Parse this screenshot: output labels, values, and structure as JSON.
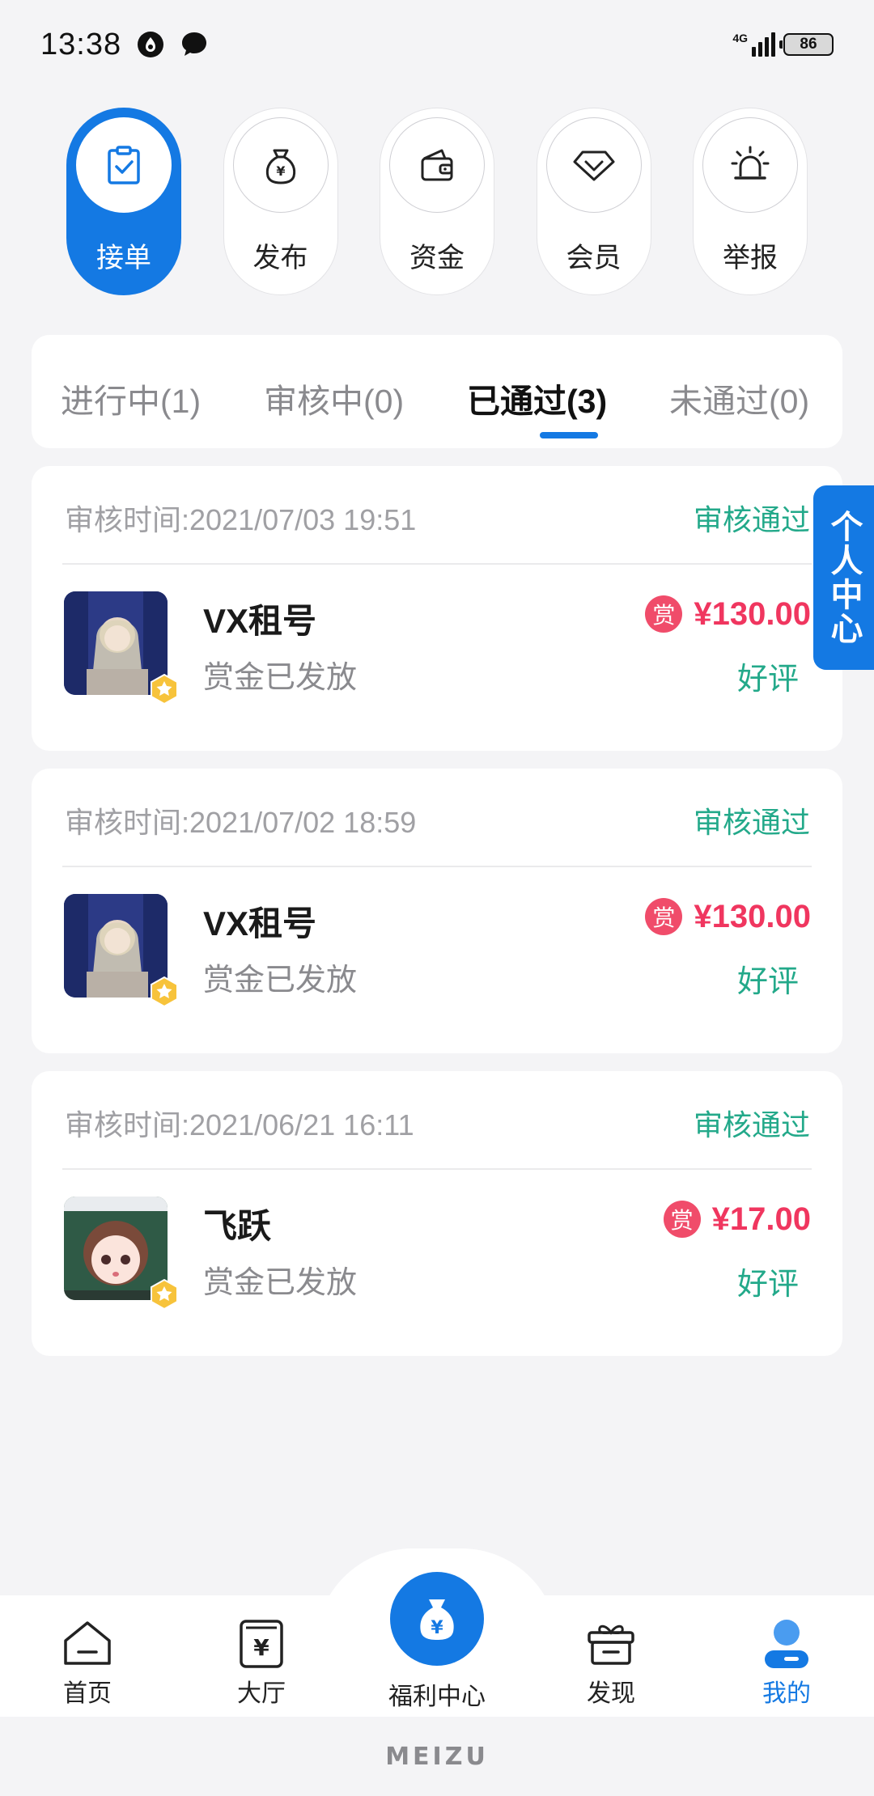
{
  "status_bar": {
    "time": "13:38",
    "network": "4G",
    "battery": "86"
  },
  "quick_actions": [
    {
      "label": "接单",
      "icon": "clipboard-check-icon",
      "active": true
    },
    {
      "label": "发布",
      "icon": "money-bag-icon",
      "active": false
    },
    {
      "label": "资金",
      "icon": "wallet-icon",
      "active": false
    },
    {
      "label": "会员",
      "icon": "diamond-icon",
      "active": false
    },
    {
      "label": "举报",
      "icon": "alarm-light-icon",
      "active": false
    }
  ],
  "tabs": [
    {
      "label": "进行中(1)",
      "active": false
    },
    {
      "label": "审核中(0)",
      "active": false
    },
    {
      "label": "已通过(3)",
      "active": true
    },
    {
      "label": "未通过(0)",
      "active": false
    }
  ],
  "tasks": [
    {
      "time": "审核时间:2021/07/03 19:51",
      "status": "审核通过",
      "title": "VX租号",
      "subtitle": "赏金已发放",
      "reward_icon": "赏",
      "price": "¥130.00",
      "review": "好评"
    },
    {
      "time": "审核时间:2021/07/02 18:59",
      "status": "审核通过",
      "title": "VX租号",
      "subtitle": "赏金已发放",
      "reward_icon": "赏",
      "price": "¥130.00",
      "review": "好评"
    },
    {
      "time": "审核时间:2021/06/21 16:11",
      "status": "审核通过",
      "title": "飞跃",
      "subtitle": "赏金已发放",
      "reward_icon": "赏",
      "price": "¥17.00",
      "review": "好评"
    }
  ],
  "floating_button": {
    "label": "个人中心"
  },
  "bottom_nav": {
    "items": [
      {
        "label": "首页",
        "icon": "home-icon"
      },
      {
        "label": "大厅",
        "icon": "yuan-receipt-icon"
      },
      {
        "label": "福利中心",
        "icon": "money-bag-icon"
      },
      {
        "label": "发现",
        "icon": "gift-box-icon"
      },
      {
        "label": "我的",
        "icon": "user-icon",
        "active": true
      }
    ]
  },
  "device_brand": "MEIZU",
  "colors": {
    "accent": "#1479e3",
    "success": "#23a98a",
    "price": "#f0365f",
    "background": "#f4f4f6"
  }
}
